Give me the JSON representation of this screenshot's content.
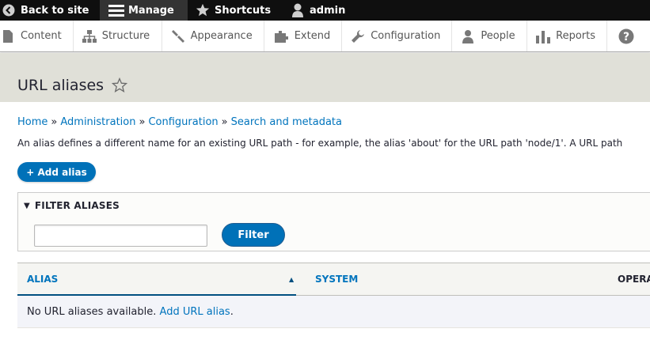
{
  "toolbar": {
    "back_label": "Back to site",
    "manage_label": "Manage",
    "shortcuts_label": "Shortcuts",
    "user_label": "admin"
  },
  "tray": {
    "items": [
      {
        "label": "Content",
        "icon": "content-icon"
      },
      {
        "label": "Structure",
        "icon": "structure-icon"
      },
      {
        "label": "Appearance",
        "icon": "appearance-icon"
      },
      {
        "label": "Extend",
        "icon": "extend-icon"
      },
      {
        "label": "Configuration",
        "icon": "configuration-icon"
      },
      {
        "label": "People",
        "icon": "people-icon"
      },
      {
        "label": "Reports",
        "icon": "reports-icon"
      }
    ],
    "help_icon": "help-icon"
  },
  "page": {
    "title": "URL aliases"
  },
  "breadcrumb": {
    "items": [
      "Home",
      "Administration",
      "Configuration",
      "Search and metadata"
    ],
    "separator": "»"
  },
  "help_text": "An alias defines a different name for an existing URL path - for example, the alias 'about' for the URL path 'node/1'. A URL path",
  "add_alias": {
    "label": "+ Add alias"
  },
  "filter": {
    "legend": "FILTER ALIASES",
    "input_value": "",
    "button_label": "Filter"
  },
  "table": {
    "headers": {
      "alias": "ALIAS",
      "system": "SYSTEM",
      "operations": "OPERA"
    },
    "empty_text": "No URL aliases available.",
    "empty_link": "Add URL alias",
    "empty_suffix": "."
  },
  "colors": {
    "toolbar_bg": "#0f0f0f",
    "manage_active_bg": "#333333",
    "link": "#0074bd",
    "primary_button": "#0071b8",
    "header_band": "#e0e0d8"
  }
}
